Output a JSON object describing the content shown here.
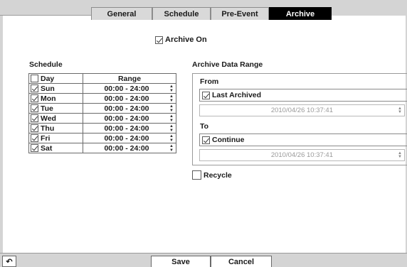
{
  "tabs": {
    "general": "General",
    "schedule": "Schedule",
    "pre_event": "Pre-Event",
    "archive": "Archive"
  },
  "archive_on": {
    "label": "Archive On",
    "checked": true
  },
  "schedule": {
    "title": "Schedule",
    "header_day": "Day",
    "header_range": "Range",
    "rows": [
      {
        "day": "Sun",
        "range": "00:00 - 24:00",
        "checked": true
      },
      {
        "day": "Mon",
        "range": "00:00 - 24:00",
        "checked": true
      },
      {
        "day": "Tue",
        "range": "00:00 - 24:00",
        "checked": true
      },
      {
        "day": "Wed",
        "range": "00:00 - 24:00",
        "checked": true
      },
      {
        "day": "Thu",
        "range": "00:00 - 24:00",
        "checked": true
      },
      {
        "day": "Fri",
        "range": "00:00 - 24:00",
        "checked": true
      },
      {
        "day": "Sat",
        "range": "00:00 - 24:00",
        "checked": true
      }
    ]
  },
  "range": {
    "title": "Archive Data Range",
    "from_label": "From",
    "last_archived_label": "Last Archived",
    "from_date": "2010/04/26  10:37:41",
    "to_label": "To",
    "continue_label": "Continue",
    "to_date": "2010/04/26  10:37:41"
  },
  "recycle_label": "Recycle",
  "buttons": {
    "back_icon": "↶",
    "save": "Save",
    "cancel": "Cancel"
  }
}
